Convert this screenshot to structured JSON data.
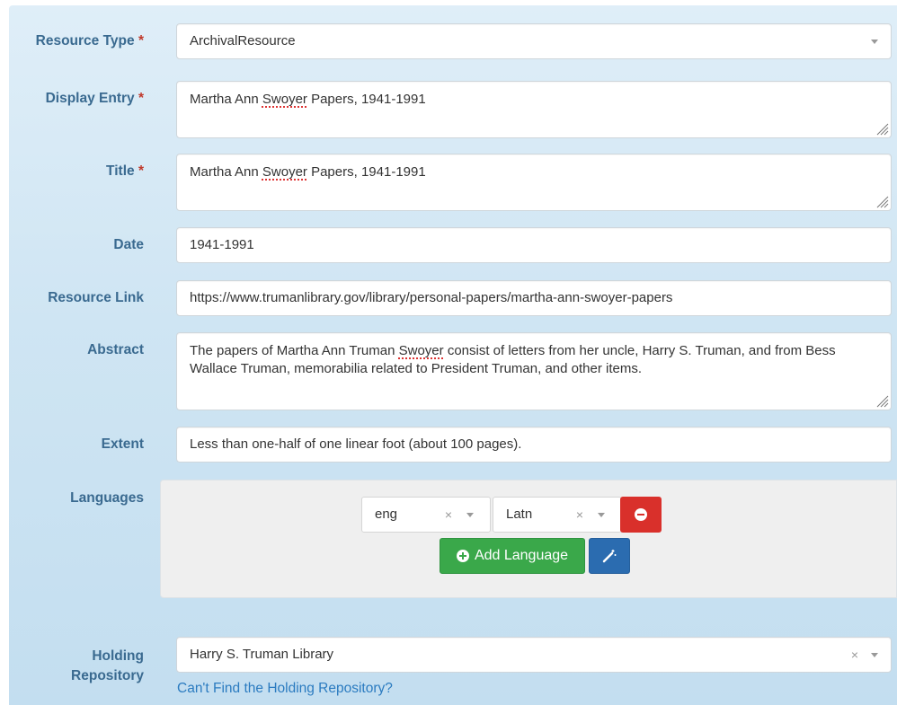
{
  "form": {
    "resource_type": {
      "label": "Resource Type",
      "required_mark": "*",
      "value": "ArchivalResource"
    },
    "display_entry": {
      "label": "Display Entry",
      "required_mark": "*",
      "value_pre": "Martha Ann ",
      "value_misspelled": "Swoyer",
      "value_post": " Papers, 1941-1991"
    },
    "title": {
      "label": "Title",
      "required_mark": "*",
      "value_pre": "Martha Ann ",
      "value_misspelled": "Swoyer",
      "value_post": " Papers, 1941-1991"
    },
    "date": {
      "label": "Date",
      "value": "1941-1991"
    },
    "resource_link": {
      "label": "Resource Link",
      "value": "https://www.trumanlibrary.gov/library/personal-papers/martha-ann-swoyer-papers"
    },
    "abstract": {
      "label": "Abstract",
      "value_pre": "The papers of Martha Ann Truman ",
      "value_misspelled": "Swoyer",
      "value_post": " consist of letters from her uncle, Harry S. Truman, and from Bess Wallace Truman, memorabilia related to President Truman, and other items."
    },
    "extent": {
      "label": "Extent",
      "value": "Less than one-half of one linear foot (about 100 pages)."
    },
    "languages": {
      "label": "Languages",
      "language_value": "eng",
      "script_value": "Latn",
      "clear_glyph": "×",
      "add_button_label": "Add Language"
    },
    "holding_repository": {
      "label_line1": "Holding",
      "label_line2": "Repository",
      "value": "Harry S. Truman Library",
      "clear_glyph": "×",
      "help_link": "Can't Find the Holding Repository?"
    }
  },
  "colors": {
    "label": "#3a6a90",
    "required": "#c0392b",
    "remove_button": "#d9302b",
    "add_button": "#3aa84a",
    "wand_button": "#2b6cb0",
    "link": "#2b7bc0"
  },
  "icons": [
    "caret-down-icon",
    "resize-grip-icon",
    "clear-icon",
    "minus-circle-icon",
    "plus-circle-icon",
    "magic-wand-icon"
  ]
}
